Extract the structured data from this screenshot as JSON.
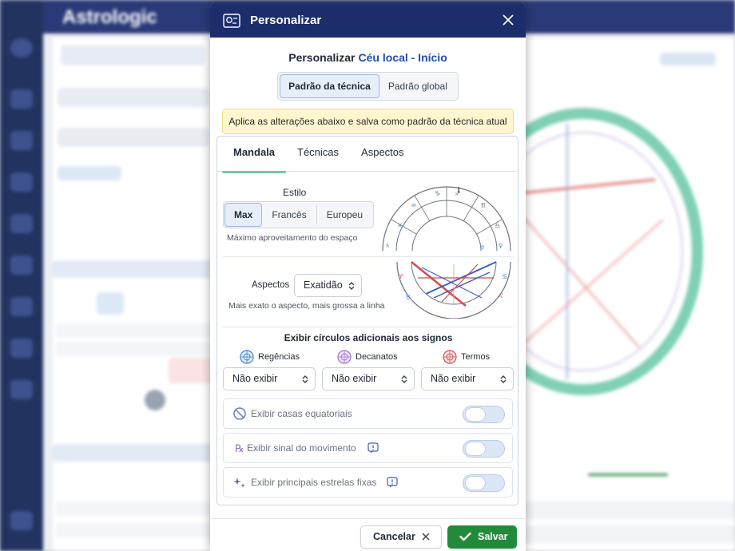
{
  "background": {
    "app_logo": "Astrologic"
  },
  "modal": {
    "title": "Personalizar",
    "subtitle_main": "Personalizar",
    "subtitle_accent": "Céu local - Início",
    "scope_tabs": [
      "Padrão da técnica",
      "Padrão global"
    ],
    "scope_active": "Padrão da técnica",
    "notice": "Aplica as alterações abaixo e salva como padrão da técnica atual",
    "tabs": [
      "Mandala",
      "Técnicas",
      "Aspectos"
    ],
    "active_tab": "Mandala",
    "estilo": {
      "label": "Estilo",
      "options": [
        "Max",
        "Francês",
        "Europeu"
      ],
      "selected": "Max",
      "help": "Máximo aproveitamento do espaço"
    },
    "aspectos": {
      "label": "Aspectos",
      "value": "Exatidão",
      "help": "Mais exato o aspecto, mais grossa a linha"
    },
    "circulos": {
      "title": "Exibir círculos adicionais aos signos",
      "columns": [
        {
          "label": "Regências",
          "value": "Não exibir",
          "color": "#3b7fc4"
        },
        {
          "label": "Decanatos",
          "value": "Não exibir",
          "color": "#9a6fd0"
        },
        {
          "label": "Termos",
          "value": "Não exibir",
          "color": "#d84a4a"
        }
      ]
    },
    "toggles": [
      {
        "label": "Exibir casas equatoriais",
        "icon": "no-symbol-icon",
        "on": false
      },
      {
        "label": "Exibir sinal do movimento",
        "icon": "retrograde-icon",
        "on": false
      },
      {
        "label": "Exibir principais estrelas fixas",
        "icon": "stars-icon",
        "on": false
      }
    ],
    "buttons": {
      "cancel": "Cancelar",
      "save": "Salvar"
    },
    "colors": {
      "header": "#1b2d6b",
      "accent": "#1f4fa8",
      "save": "#228a3b",
      "notice_bg": "#fdf6cf"
    }
  }
}
